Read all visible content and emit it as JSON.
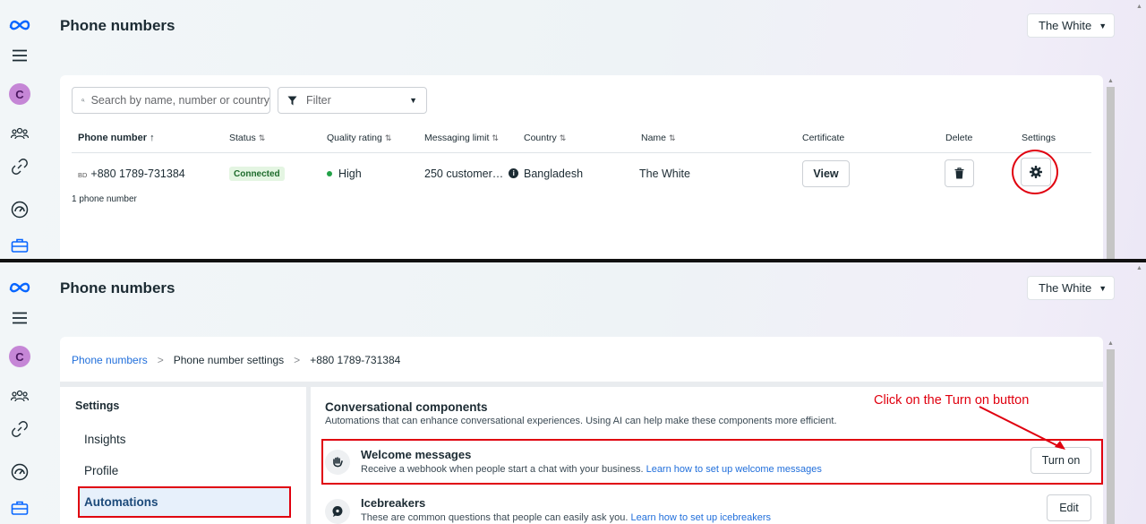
{
  "top_panel": {
    "page_title": "Phone numbers",
    "business_selector": "The White",
    "avatar_letter": "C",
    "search_placeholder": "Search by name, number or country",
    "filter_label": "Filter",
    "columns": [
      "Phone number",
      "Status",
      "Quality rating",
      "Messaging limit",
      "Country",
      "Name",
      "Certificate",
      "Delete",
      "Settings"
    ],
    "sort_up_glyph": "↑",
    "sort_glyph": "⇅",
    "row": {
      "country_code": "BD",
      "phone": "+880 1789-731384",
      "status": "Connected",
      "quality": "High",
      "messaging_limit": "250 customer…",
      "country": "Bangladesh",
      "name": "The White",
      "certificate_button": "View"
    },
    "count_text": "1 phone number"
  },
  "bottom_panel": {
    "page_title": "Phone numbers",
    "business_selector": "The White",
    "avatar_letter": "C",
    "breadcrumb": [
      "Phone numbers",
      "Phone number settings",
      "+880 1789-731384"
    ],
    "nav": {
      "heading": "Settings",
      "items": [
        "Insights",
        "Profile",
        "Automations"
      ]
    },
    "section": {
      "title": "Conversational components",
      "subtitle": "Automations that can enhance conversational experiences. Using AI can help make these components more efficient."
    },
    "items": [
      {
        "title": "Welcome messages",
        "desc": "Receive a webhook when people start a chat with your business.",
        "link": "Learn how to set up welcome messages",
        "button": "Turn on"
      },
      {
        "title": "Icebreakers",
        "desc": "These are common questions that people can easily ask you.",
        "link": "Learn how to set up icebreakers",
        "button": "Edit"
      }
    ],
    "annotation": "Click on the Turn on button"
  },
  "colors": {
    "annotation_red": "#e0000f",
    "link_blue": "#216fdb",
    "status_green": "#22a147"
  },
  "icons": [
    "meta-logo-icon",
    "menu-icon",
    "people-icon",
    "link-icon",
    "dashboard-icon",
    "briefcase-icon",
    "search-icon",
    "filter-icon",
    "info-icon",
    "trash-icon",
    "gear-icon",
    "wave-hand-icon",
    "chat-bubble-icon"
  ]
}
